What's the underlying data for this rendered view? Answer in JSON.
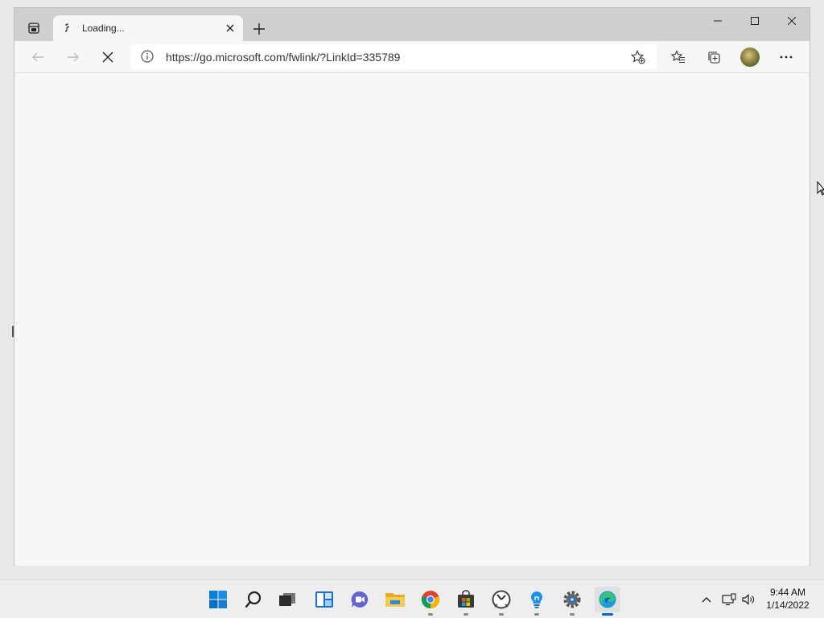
{
  "browser": {
    "tab": {
      "title": "Loading...",
      "favicon": "loading-spinner-icon"
    },
    "address": {
      "url": "https://go.microsoft.com/fwlink/?LinkId=335789"
    },
    "toolbar_icons": [
      "back-arrow-icon",
      "forward-arrow-icon",
      "stop-loading-icon",
      "site-info-icon",
      "add-favorite-icon",
      "favorites-icon",
      "collections-icon",
      "profile-avatar",
      "more-icon"
    ]
  },
  "taskbar": {
    "apps": [
      "windows-start-icon",
      "search-icon",
      "task-view-icon",
      "widgets-icon",
      "teams-chat-icon",
      "file-explorer-icon",
      "chrome-icon",
      "store-icon",
      "clock-app-icon",
      "tips-icon",
      "settings-icon",
      "edge-icon"
    ],
    "tray": {
      "time": "9:44 AM",
      "date": "1/14/2022"
    }
  },
  "colors": {
    "accent": "#0067c0",
    "window_bg": "#f7f7f7",
    "tabstrip": "#cfcfcf"
  }
}
